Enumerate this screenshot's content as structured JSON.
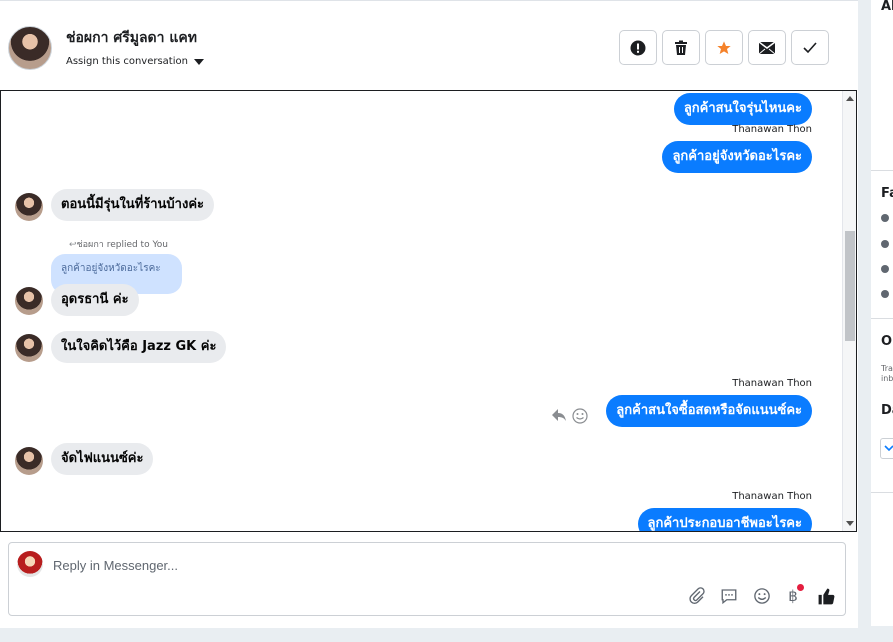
{
  "header": {
    "contact_name": "ช่อผกา ศรีมูลดา แคท",
    "assign_label": "Assign this conversation",
    "actions": [
      "spam",
      "delete",
      "star",
      "mark-unread",
      "done"
    ]
  },
  "thread": {
    "messages": [
      {
        "dir": "out",
        "text": "ลูกค้าสนใจรุ่นไหนคะ"
      },
      {
        "sender": "Thanawan Thon"
      },
      {
        "dir": "out",
        "text": "ลูกค้าอยู่จังหวัดอะไรคะ"
      },
      {
        "dir": "in",
        "text": "ตอนนี้มีรุ่นในที่ร้านบ้างค่ะ"
      },
      {
        "reply_note": "ช่อผกา replied to You",
        "quoted": "ลูกค้าอยู่จังหวัดอะไรคะ"
      },
      {
        "dir": "in",
        "text": "อุดรธานี ค่ะ"
      },
      {
        "dir": "in",
        "text": "ในใจคิดไว้คือ Jazz GK ค่ะ"
      },
      {
        "sender": "Thanawan Thon"
      },
      {
        "dir": "out",
        "text": "ลูกค้าสนใจซื้อสดหรือจัดแนนซ์คะ"
      },
      {
        "dir": "in",
        "text": "จัดไฟแนนซ์ค่ะ"
      },
      {
        "sender": "Thanawan Thon"
      },
      {
        "dir": "out",
        "text": "ลูกค้าประกอบอาชีพอะไรคะ"
      }
    ]
  },
  "composer": {
    "placeholder": "Reply in Messenger...",
    "tools": [
      "attach",
      "saved-reply",
      "emoji",
      "payment",
      "like"
    ]
  },
  "sidebar": {
    "headings": [
      "Al",
      "Fa",
      "O",
      "Da"
    ],
    "snippet": [
      "Tra",
      "inb"
    ]
  },
  "colors": {
    "accent": "#0a7cff",
    "star": "#f5822a",
    "incoming": "#e9ebee",
    "quote": "#cfe2ff"
  }
}
